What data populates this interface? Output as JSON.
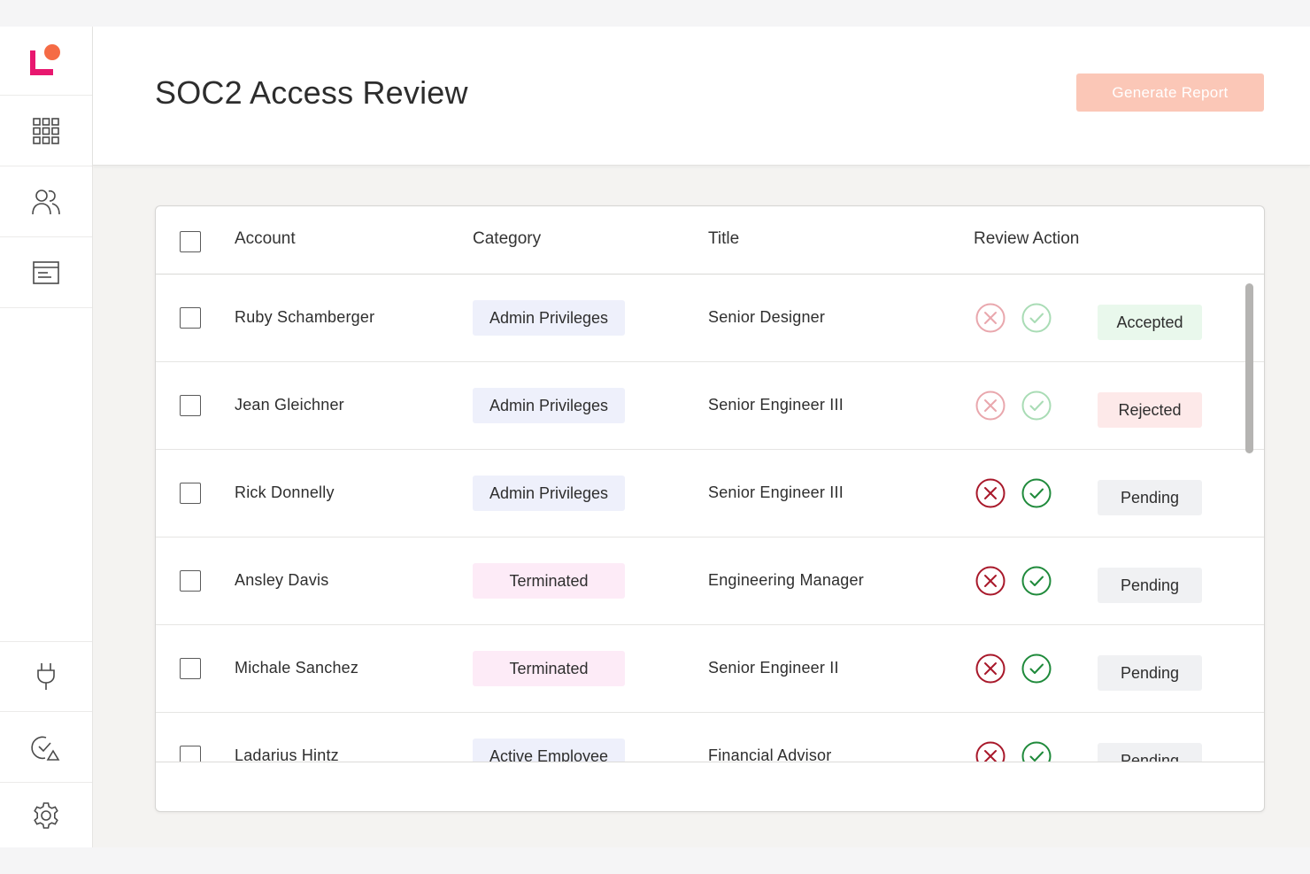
{
  "header": {
    "title": "SOC2 Access Review",
    "generate_label": "Generate Report"
  },
  "sidebar": {
    "items": [
      {
        "name": "logo",
        "icon": "logo-icon"
      },
      {
        "name": "dashboard",
        "icon": "grid-icon"
      },
      {
        "name": "users",
        "icon": "users-icon"
      },
      {
        "name": "reports",
        "icon": "document-icon"
      },
      {
        "name": "integrations",
        "icon": "plug-icon"
      },
      {
        "name": "compliance",
        "icon": "check-badge-icon"
      },
      {
        "name": "settings",
        "icon": "gear-icon"
      }
    ]
  },
  "table": {
    "columns": [
      "Account",
      "Category",
      "Title",
      "Review Action"
    ],
    "rows": [
      {
        "account": "Ruby Schamberger",
        "category": "Admin Privileges",
        "category_kind": "admin",
        "title": "Senior Designer",
        "status": "Accepted",
        "status_kind": "accepted",
        "actions_muted": true
      },
      {
        "account": "Jean Gleichner",
        "category": "Admin Privileges",
        "category_kind": "admin",
        "title": "Senior Engineer III",
        "status": "Rejected",
        "status_kind": "rejected",
        "actions_muted": true
      },
      {
        "account": "Rick Donnelly",
        "category": "Admin Privileges",
        "category_kind": "admin",
        "title": "Senior Engineer III",
        "status": "Pending",
        "status_kind": "pending",
        "actions_muted": false
      },
      {
        "account": "Ansley Davis",
        "category": "Terminated",
        "category_kind": "terminated",
        "title": "Engineering Manager",
        "status": "Pending",
        "status_kind": "pending",
        "actions_muted": false
      },
      {
        "account": "Michale Sanchez",
        "category": "Terminated",
        "category_kind": "terminated",
        "title": "Senior Engineer II",
        "status": "Pending",
        "status_kind": "pending",
        "actions_muted": false
      },
      {
        "account": "Ladarius Hintz",
        "category": "Active Employee",
        "category_kind": "active",
        "title": "Financial Advisor",
        "status": "Pending",
        "status_kind": "pending",
        "actions_muted": false
      }
    ]
  },
  "colors": {
    "brand_pink": "#e8176f",
    "brand_orange": "#f56b45",
    "chip_admin": "#eef0fb",
    "chip_terminated": "#fdebf7",
    "chip_active": "#eef0fb",
    "status_accepted": "#e9f8ec",
    "status_rejected": "#fde9e9",
    "status_pending": "#f0f1f3",
    "reject_red": "#a8182a",
    "accept_green": "#1f8a3b"
  }
}
